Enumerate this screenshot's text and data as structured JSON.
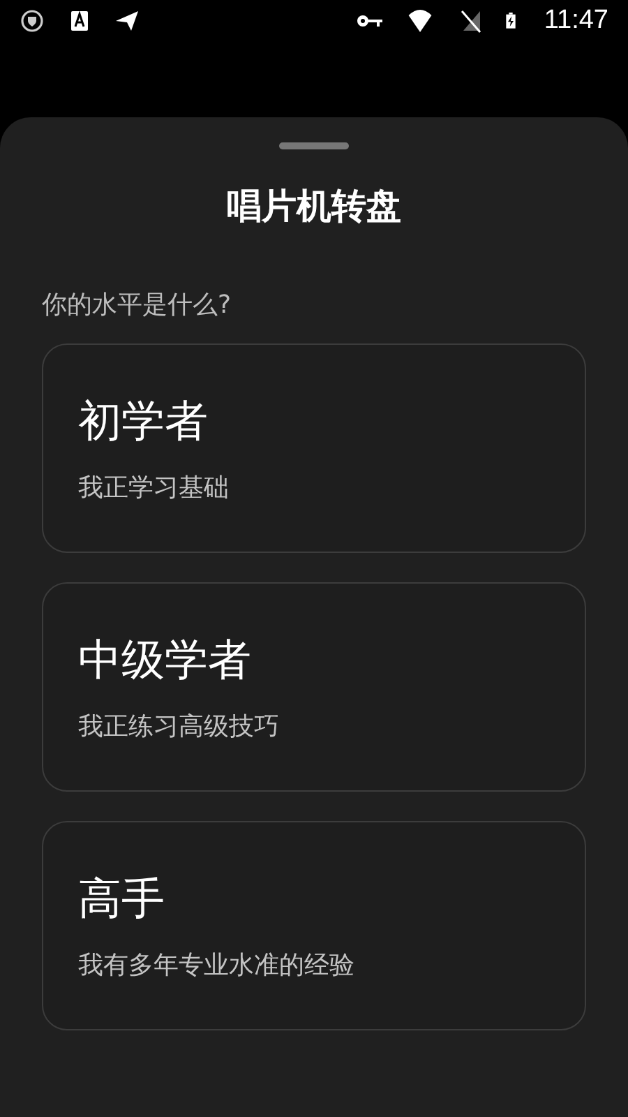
{
  "status_bar": {
    "time": "11:47"
  },
  "sheet": {
    "title": "唱片机转盘",
    "question": "你的水平是什么?",
    "options": [
      {
        "title": "初学者",
        "subtitle": "我正学习基础"
      },
      {
        "title": "中级学者",
        "subtitle": "我正练习高级技巧"
      },
      {
        "title": "高手",
        "subtitle": "我有多年专业水准的经验"
      }
    ]
  }
}
